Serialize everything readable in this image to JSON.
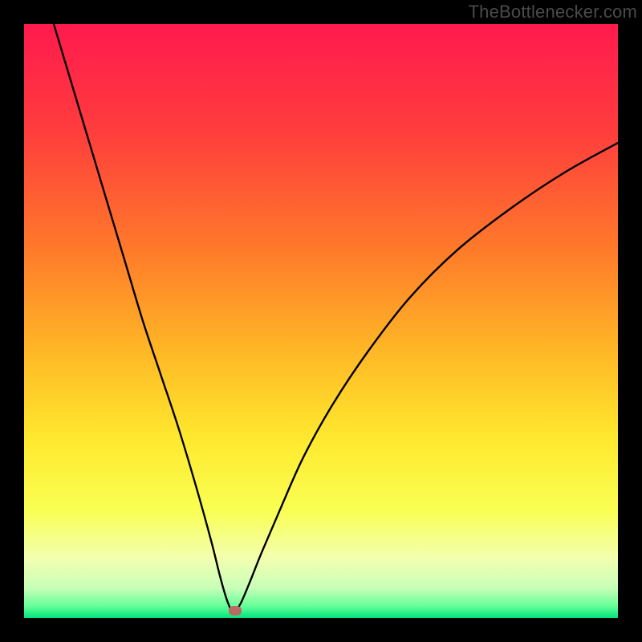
{
  "watermark": "TheBottlenecker.com",
  "colors": {
    "frame": "#000000",
    "gradient_stops": [
      {
        "pct": 0,
        "color": "#ff1a4e"
      },
      {
        "pct": 18,
        "color": "#ff3d3d"
      },
      {
        "pct": 38,
        "color": "#ff7a2a"
      },
      {
        "pct": 55,
        "color": "#ffb726"
      },
      {
        "pct": 70,
        "color": "#ffe92e"
      },
      {
        "pct": 82,
        "color": "#f9ff54"
      },
      {
        "pct": 90,
        "color": "#f3ffb0"
      },
      {
        "pct": 95,
        "color": "#c7ffb8"
      },
      {
        "pct": 98,
        "color": "#66ff99"
      },
      {
        "pct": 100,
        "color": "#00e37a"
      }
    ],
    "curve": "#000000",
    "marker": "#b96a62"
  },
  "chart_data": {
    "type": "line",
    "title": "",
    "xlabel": "",
    "ylabel": "",
    "xlim": [
      0,
      100
    ],
    "ylim": [
      0,
      100
    ],
    "grid": false,
    "legend": false,
    "annotations": [
      "TheBottlenecker.com"
    ],
    "series": [
      {
        "name": "bottleneck-curve",
        "x": [
          5,
          8,
          11,
          14,
          17,
          20,
          23,
          26,
          29,
          31.5,
          33,
          34,
          34.8,
          35.5,
          36.5,
          38,
          40,
          43,
          47,
          52,
          58,
          65,
          73,
          82,
          91,
          100
        ],
        "y": [
          100,
          90,
          80,
          70,
          60,
          50,
          41,
          32,
          22,
          13,
          7,
          3.5,
          1.5,
          1.2,
          2.5,
          6,
          11,
          18,
          27,
          36,
          45,
          54,
          62,
          69,
          75,
          80
        ]
      }
    ],
    "markers": [
      {
        "name": "optimal-point",
        "x": 35.5,
        "y": 1.2
      }
    ]
  }
}
